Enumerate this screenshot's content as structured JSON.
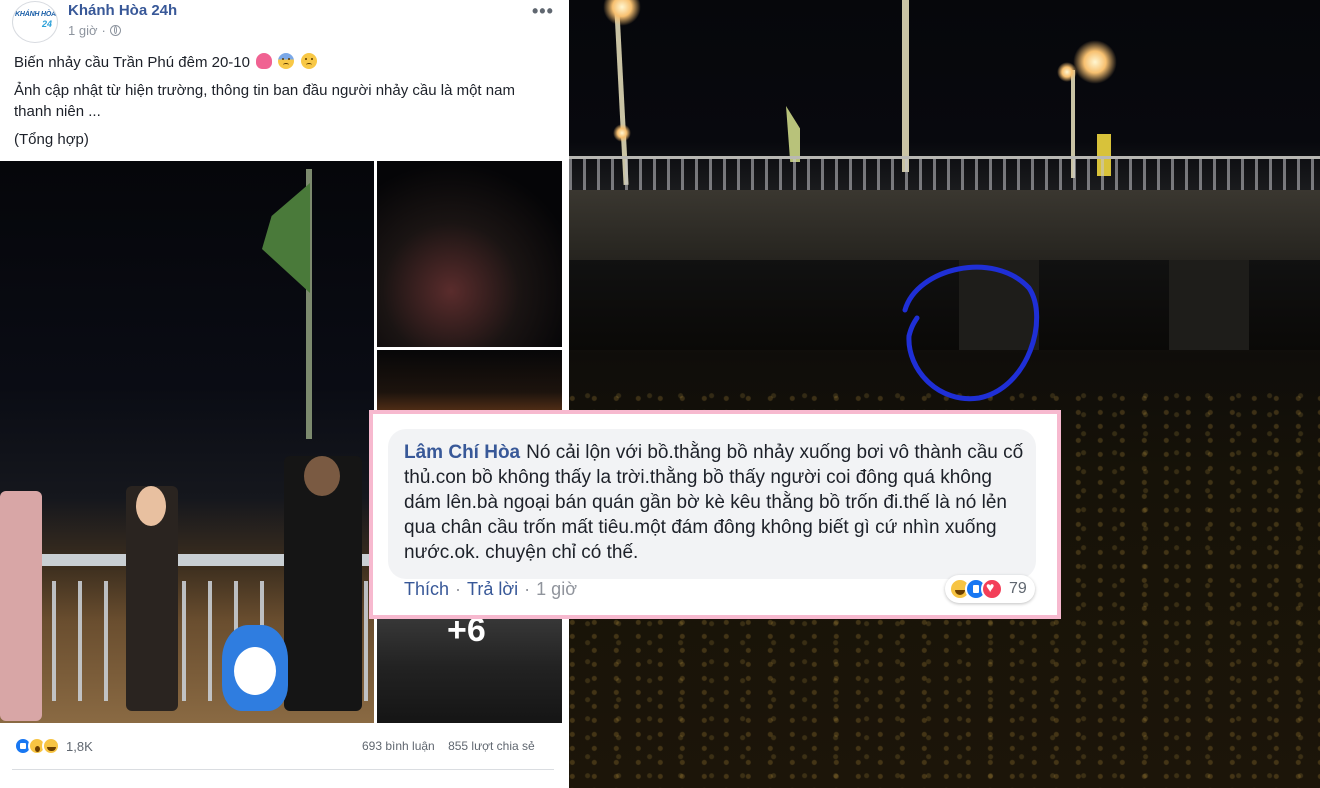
{
  "post": {
    "page_name": "Khánh Hòa 24h",
    "logo_text_main": "KHÁNH HÒA",
    "logo_text_sub": "24",
    "time": "1 giờ",
    "text_line1": "Biến nhảy cầu Trần Phú đêm 20-10",
    "text_line2": "Ảnh cập nhật từ hiện trường, thông tin ban đầu người nhảy cầu là một nam thanh niên ...",
    "text_line3": "(Tổng hợp)",
    "more_photos": "+6",
    "reaction_count": "1,8K",
    "comments": "693 bình luận",
    "shares": "855 lượt chia sẻ",
    "icons": {
      "privacy": "globe-icon",
      "more": "more-options-icon"
    },
    "colors": {
      "link": "#385898",
      "meta": "#8d949e"
    }
  },
  "comment": {
    "author": "Lâm Chí Hòa",
    "text": "Nó cải lộn với bồ.thằng bồ nhảy xuống bơi vô thành cầu cố thủ.con bồ không thấy la trời.thằng bồ thấy người coi đông quá không dám lên.bà ngoại bán quán gần bờ kè kêu thằng bồ trốn đi.thế là nó lẻn qua chân cầu trốn mất tiêu.một đám đông không biết gì cứ nhìn xuống nước.ok. chuyện chỉ có thế.",
    "like_label": "Thích",
    "reply_label": "Trả lời",
    "time": "1 giờ",
    "separator": "·",
    "reaction_count": "79",
    "colors": {
      "frame": "#f7b9cf",
      "bubble": "#f2f3f5"
    }
  }
}
